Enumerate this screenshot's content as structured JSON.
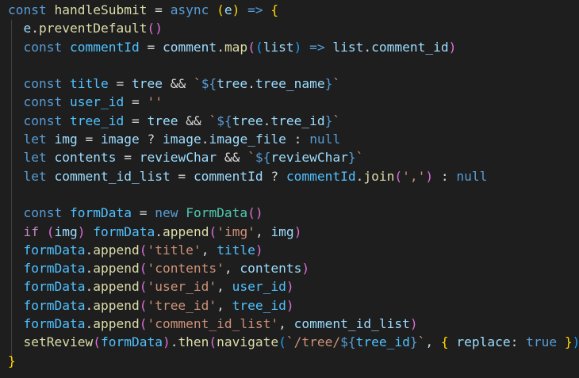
{
  "editor": {
    "lines": [
      [
        [
          "kw",
          "const"
        ],
        [
          "op",
          " "
        ],
        [
          "fn",
          "handleSubmit"
        ],
        [
          "op",
          " = "
        ],
        [
          "kw",
          "async"
        ],
        [
          "op",
          " "
        ],
        [
          "b1",
          "("
        ],
        [
          "var",
          "e"
        ],
        [
          "b1",
          ")"
        ],
        [
          "op",
          " "
        ],
        [
          "kw",
          "=>"
        ],
        [
          "op",
          " "
        ],
        [
          "b1",
          "{"
        ]
      ],
      [
        [
          "op",
          "  "
        ],
        [
          "var",
          "e"
        ],
        [
          "op",
          "."
        ],
        [
          "fn",
          "preventDefault"
        ],
        [
          "b2",
          "()"
        ]
      ],
      [
        [
          "op",
          "  "
        ],
        [
          "kw",
          "const"
        ],
        [
          "op",
          " "
        ],
        [
          "cst",
          "commentId"
        ],
        [
          "op",
          " = "
        ],
        [
          "var",
          "comment"
        ],
        [
          "op",
          "."
        ],
        [
          "fn",
          "map"
        ],
        [
          "b2",
          "("
        ],
        [
          "b3",
          "("
        ],
        [
          "var",
          "list"
        ],
        [
          "b3",
          ")"
        ],
        [
          "op",
          " "
        ],
        [
          "kw",
          "=>"
        ],
        [
          "op",
          " "
        ],
        [
          "var",
          "list"
        ],
        [
          "op",
          "."
        ],
        [
          "var",
          "comment_id"
        ],
        [
          "b2",
          ")"
        ]
      ],
      [],
      [
        [
          "op",
          "  "
        ],
        [
          "kw",
          "const"
        ],
        [
          "op",
          " "
        ],
        [
          "cst",
          "title"
        ],
        [
          "op",
          " = "
        ],
        [
          "var",
          "tree"
        ],
        [
          "op",
          " && "
        ],
        [
          "str",
          "`"
        ],
        [
          "tpl",
          "${"
        ],
        [
          "var",
          "tree"
        ],
        [
          "op",
          "."
        ],
        [
          "var",
          "tree_name"
        ],
        [
          "tpl",
          "}"
        ],
        [
          "str",
          "`"
        ]
      ],
      [
        [
          "op",
          "  "
        ],
        [
          "kw",
          "const"
        ],
        [
          "op",
          " "
        ],
        [
          "cst",
          "user_id"
        ],
        [
          "op",
          " = "
        ],
        [
          "str",
          "''"
        ]
      ],
      [
        [
          "op",
          "  "
        ],
        [
          "kw",
          "const"
        ],
        [
          "op",
          " "
        ],
        [
          "cst",
          "tree_id"
        ],
        [
          "op",
          " = "
        ],
        [
          "var",
          "tree"
        ],
        [
          "op",
          " && "
        ],
        [
          "str",
          "`"
        ],
        [
          "tpl",
          "${"
        ],
        [
          "var",
          "tree"
        ],
        [
          "op",
          "."
        ],
        [
          "var",
          "tree_id"
        ],
        [
          "tpl",
          "}"
        ],
        [
          "str",
          "`"
        ]
      ],
      [
        [
          "op",
          "  "
        ],
        [
          "kw",
          "let"
        ],
        [
          "op",
          " "
        ],
        [
          "var",
          "img"
        ],
        [
          "op",
          " = "
        ],
        [
          "var",
          "image"
        ],
        [
          "op",
          " ? "
        ],
        [
          "var",
          "image"
        ],
        [
          "op",
          "."
        ],
        [
          "var",
          "image_file"
        ],
        [
          "op",
          " : "
        ],
        [
          "kw",
          "null"
        ]
      ],
      [
        [
          "op",
          "  "
        ],
        [
          "kw",
          "let"
        ],
        [
          "op",
          " "
        ],
        [
          "var",
          "contents"
        ],
        [
          "op",
          " = "
        ],
        [
          "var",
          "reviewChar"
        ],
        [
          "op",
          " && "
        ],
        [
          "str",
          "`"
        ],
        [
          "tpl",
          "${"
        ],
        [
          "var",
          "reviewChar"
        ],
        [
          "tpl",
          "}"
        ],
        [
          "str",
          "`"
        ]
      ],
      [
        [
          "op",
          "  "
        ],
        [
          "kw",
          "let"
        ],
        [
          "op",
          " "
        ],
        [
          "var",
          "comment_id_list"
        ],
        [
          "op",
          " = "
        ],
        [
          "var",
          "commentId"
        ],
        [
          "op",
          " ? "
        ],
        [
          "cst",
          "commentId"
        ],
        [
          "op",
          "."
        ],
        [
          "fn",
          "join"
        ],
        [
          "b2",
          "("
        ],
        [
          "str",
          "','"
        ],
        [
          "b2",
          ")"
        ],
        [
          "op",
          " : "
        ],
        [
          "kw",
          "null"
        ]
      ],
      [],
      [
        [
          "op",
          "  "
        ],
        [
          "kw",
          "const"
        ],
        [
          "op",
          " "
        ],
        [
          "cst",
          "formData"
        ],
        [
          "op",
          " = "
        ],
        [
          "kw",
          "new"
        ],
        [
          "op",
          " "
        ],
        [
          "cls",
          "FormData"
        ],
        [
          "b2",
          "()"
        ]
      ],
      [
        [
          "op",
          "  "
        ],
        [
          "ctl",
          "if"
        ],
        [
          "op",
          " "
        ],
        [
          "b2",
          "("
        ],
        [
          "var",
          "img"
        ],
        [
          "b2",
          ")"
        ],
        [
          "op",
          " "
        ],
        [
          "cst",
          "formData"
        ],
        [
          "op",
          "."
        ],
        [
          "fn",
          "append"
        ],
        [
          "b2",
          "("
        ],
        [
          "str",
          "'img'"
        ],
        [
          "op",
          ", "
        ],
        [
          "var",
          "img"
        ],
        [
          "b2",
          ")"
        ]
      ],
      [
        [
          "op",
          "  "
        ],
        [
          "cst",
          "formData"
        ],
        [
          "op",
          "."
        ],
        [
          "fn",
          "append"
        ],
        [
          "b2",
          "("
        ],
        [
          "str",
          "'title'"
        ],
        [
          "op",
          ", "
        ],
        [
          "cst",
          "title"
        ],
        [
          "b2",
          ")"
        ]
      ],
      [
        [
          "op",
          "  "
        ],
        [
          "cst",
          "formData"
        ],
        [
          "op",
          "."
        ],
        [
          "fn",
          "append"
        ],
        [
          "b2",
          "("
        ],
        [
          "str",
          "'contents'"
        ],
        [
          "op",
          ", "
        ],
        [
          "var",
          "contents"
        ],
        [
          "b2",
          ")"
        ]
      ],
      [
        [
          "op",
          "  "
        ],
        [
          "cst",
          "formData"
        ],
        [
          "op",
          "."
        ],
        [
          "fn",
          "append"
        ],
        [
          "b2",
          "("
        ],
        [
          "str",
          "'user_id'"
        ],
        [
          "op",
          ", "
        ],
        [
          "cst",
          "user_id"
        ],
        [
          "b2",
          ")"
        ]
      ],
      [
        [
          "op",
          "  "
        ],
        [
          "cst",
          "formData"
        ],
        [
          "op",
          "."
        ],
        [
          "fn",
          "append"
        ],
        [
          "b2",
          "("
        ],
        [
          "str",
          "'tree_id'"
        ],
        [
          "op",
          ", "
        ],
        [
          "cst",
          "tree_id"
        ],
        [
          "b2",
          ")"
        ]
      ],
      [
        [
          "op",
          "  "
        ],
        [
          "cst",
          "formData"
        ],
        [
          "op",
          "."
        ],
        [
          "fn",
          "append"
        ],
        [
          "b2",
          "("
        ],
        [
          "str",
          "'comment_id_list'"
        ],
        [
          "op",
          ", "
        ],
        [
          "var",
          "comment_id_list"
        ],
        [
          "b2",
          ")"
        ]
      ],
      [
        [
          "op",
          "  "
        ],
        [
          "fn",
          "setReview"
        ],
        [
          "b2",
          "("
        ],
        [
          "cst",
          "formData"
        ],
        [
          "b2",
          ")"
        ],
        [
          "op",
          "."
        ],
        [
          "fn",
          "then"
        ],
        [
          "b2",
          "("
        ],
        [
          "fn",
          "navigate"
        ],
        [
          "b3",
          "("
        ],
        [
          "str",
          "`/tree/"
        ],
        [
          "tpl",
          "${"
        ],
        [
          "cst",
          "tree_id"
        ],
        [
          "tpl",
          "}"
        ],
        [
          "str",
          "`"
        ],
        [
          "op",
          ", "
        ],
        [
          "b1",
          "{"
        ],
        [
          "op",
          " "
        ],
        [
          "var",
          "replace"
        ],
        [
          "op",
          ": "
        ],
        [
          "kw",
          "true"
        ],
        [
          "op",
          " "
        ],
        [
          "b1",
          "}"
        ],
        [
          "b3",
          ")"
        ],
        [
          "b2",
          ")"
        ]
      ],
      [
        [
          "b1",
          "}"
        ]
      ]
    ]
  }
}
